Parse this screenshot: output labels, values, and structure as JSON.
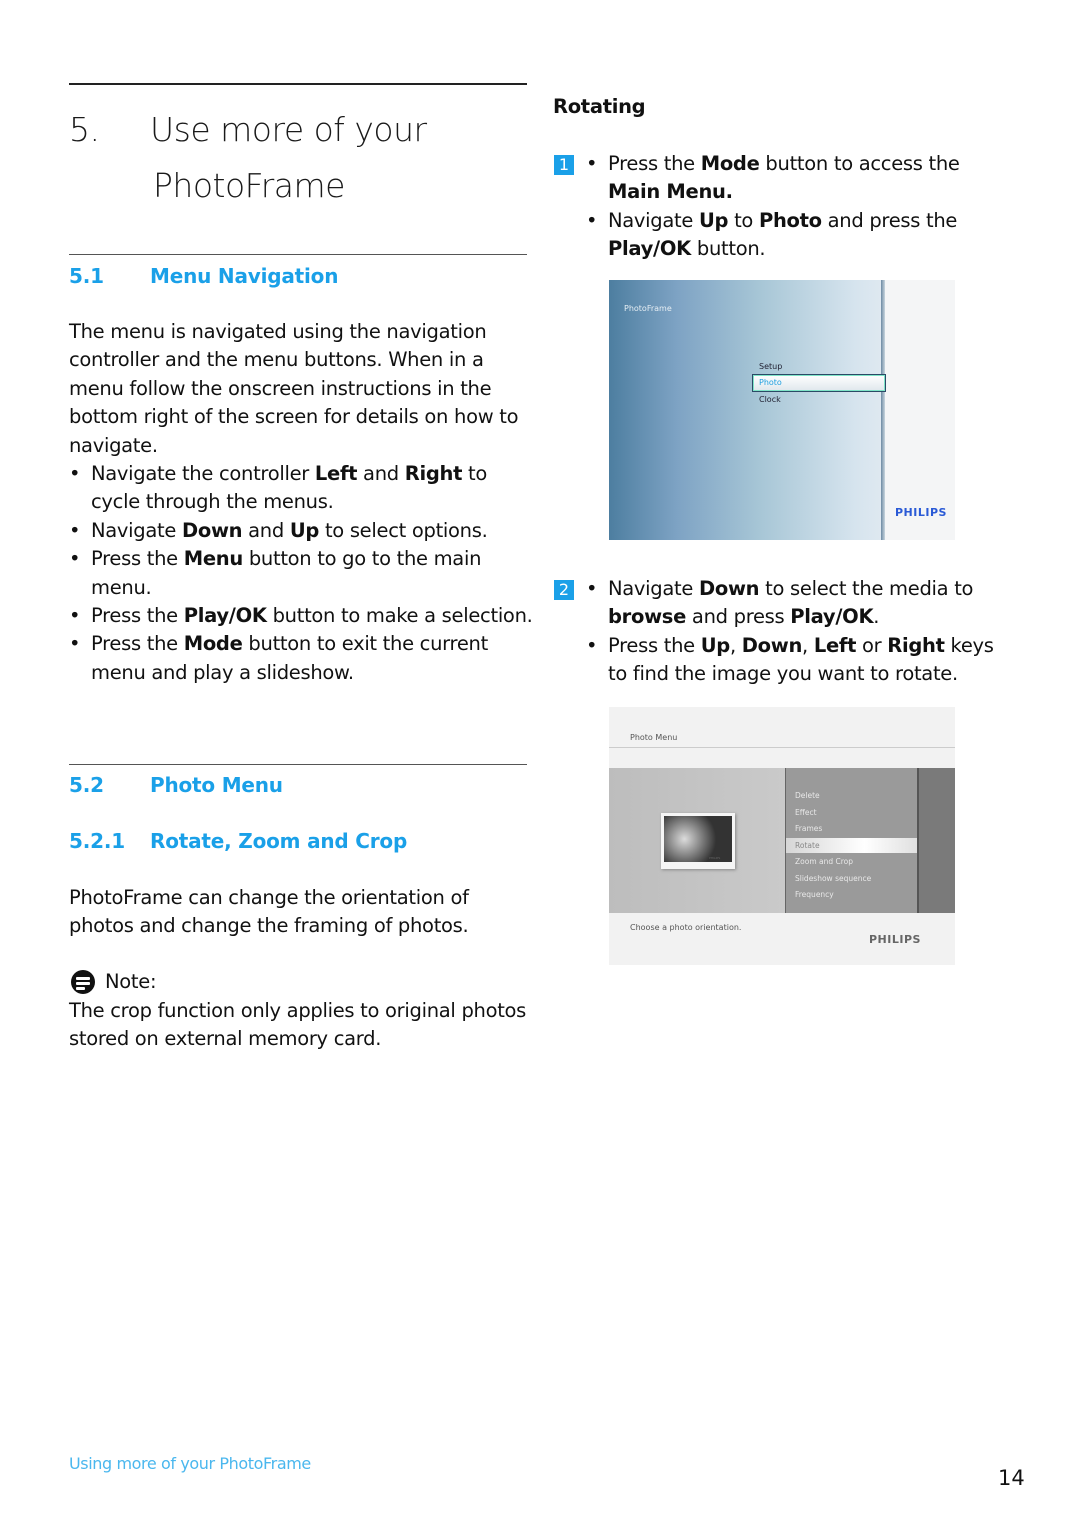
{
  "chapter": {
    "number": "5.",
    "title_line1": "Use more of your",
    "title_line2": "PhotoFrame"
  },
  "section_5_1": {
    "number": "5.1",
    "title": "Menu Navigation",
    "intro_lines": [
      "The menu is navigated using the navigation",
      "controller and the menu buttons. When in a",
      "menu follow the onscreen instructions in the",
      "bottom right of the screen for details on how to",
      "navigate."
    ],
    "bullets": [
      {
        "parts": [
          {
            "t": "Navigate the controller "
          },
          {
            "b": "Left"
          },
          {
            "t": " and "
          },
          {
            "b": "Right"
          },
          {
            "t": " to cycle through the menus."
          }
        ]
      },
      {
        "parts": [
          {
            "t": "Navigate "
          },
          {
            "b": "Down"
          },
          {
            "t": " and "
          },
          {
            "b": "Up"
          },
          {
            "t": " to select options."
          }
        ]
      },
      {
        "parts": [
          {
            "t": "Press the "
          },
          {
            "b": "Menu"
          },
          {
            "t": " button to go to the main menu."
          }
        ]
      },
      {
        "parts": [
          {
            "t": "Press the "
          },
          {
            "b": "Play/OK"
          },
          {
            "t": " button to make a selection."
          }
        ]
      },
      {
        "parts": [
          {
            "t": "Press the "
          },
          {
            "b": "Mode"
          },
          {
            "t": " button to exit the current menu and play a slideshow."
          }
        ]
      }
    ]
  },
  "section_5_2": {
    "number": "5.2",
    "title": "Photo Menu"
  },
  "section_5_2_1": {
    "number": "5.2.1",
    "title": "Rotate, Zoom and Crop",
    "body": "PhotoFrame can change the orientation of photos and change the framing of photos."
  },
  "note": {
    "label": "Note:",
    "text": "The crop function only applies to original photos stored on external memory card."
  },
  "rotating": {
    "heading": "Rotating",
    "steps": [
      {
        "badge": "1",
        "bullets": [
          {
            "parts": [
              {
                "t": "Press the "
              },
              {
                "b": "Mode"
              },
              {
                "t": " button to access the "
              },
              {
                "b": "Main Menu."
              }
            ]
          },
          {
            "parts": [
              {
                "t": "Navigate "
              },
              {
                "b": "Up"
              },
              {
                "t": " to "
              },
              {
                "b": "Photo"
              },
              {
                "t": " and press the "
              },
              {
                "b": "Play/OK"
              },
              {
                "t": " button."
              }
            ]
          }
        ]
      },
      {
        "badge": "2",
        "bullets": [
          {
            "parts": [
              {
                "t": "Navigate "
              },
              {
                "b": "Down"
              },
              {
                "t": " to select the media to "
              },
              {
                "b": "browse"
              },
              {
                "t": " and press "
              },
              {
                "b": "Play/OK"
              },
              {
                "t": "."
              }
            ]
          },
          {
            "parts": [
              {
                "t": "Press the "
              },
              {
                "b": "Up"
              },
              {
                "t": ", "
              },
              {
                "b": "Down"
              },
              {
                "t": ", "
              },
              {
                "b": "Left"
              },
              {
                "t": " or "
              },
              {
                "b": "Right"
              },
              {
                "t": " keys to find the image you want to rotate."
              }
            ]
          }
        ]
      }
    ]
  },
  "screenshot_main_menu": {
    "title": "PhotoFrame",
    "items": [
      "Setup",
      "Photo",
      "Clock"
    ],
    "selected": "Photo",
    "brand": "PHILIPS"
  },
  "screenshot_photo_menu": {
    "title": "Photo Menu",
    "items": [
      "Delete",
      "Effect",
      "Frames",
      "Rotate",
      "Zoom and Crop",
      "Slideshow sequence",
      "Frequency"
    ],
    "selected": "Rotate",
    "hint": "Choose a photo orientation.",
    "brand": "PHILIPS",
    "thumb_brand": "PHILIPS"
  },
  "footer": {
    "section_label": "Using more of your PhotoFrame",
    "page_number": "14"
  }
}
